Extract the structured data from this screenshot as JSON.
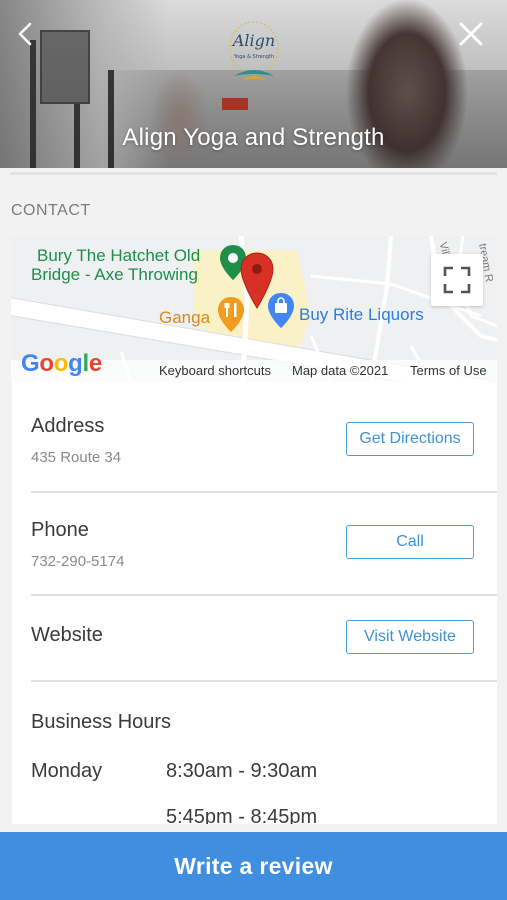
{
  "header": {
    "title": "Align Yoga and Strength",
    "logo_text": "Align",
    "logo_subtext": "Yoga & Strength"
  },
  "icons": {
    "back": "chevron-left-icon",
    "close": "close-icon",
    "fullscreen": "fullscreen-icon",
    "map_pin": "map-pin-icon"
  },
  "contact": {
    "section_label": "CONTACT"
  },
  "map": {
    "poi_hatchet_line1": "Bury The Hatchet Old",
    "poi_hatchet_line2": "Bridge - Axe Throwing",
    "poi_ganga": "Ganga",
    "poi_buyrite": "Buy Rite Liquors",
    "street_villa": "Vill",
    "street_stream": "tream R",
    "google_logo": "Google",
    "keyboard_shortcuts": "Keyboard shortcuts",
    "map_data": "Map data ©2021",
    "terms": "Terms of Use"
  },
  "address": {
    "title": "Address",
    "value": "435 Route 34",
    "button": "Get Directions"
  },
  "phone": {
    "title": "Phone",
    "value": "732-290-5174",
    "button": "Call"
  },
  "website": {
    "title": "Website",
    "button": "Visit Website"
  },
  "hours": {
    "title": "Business Hours",
    "rows": [
      {
        "day": "Monday",
        "time1": "8:30am - 9:30am",
        "time2": "5:45pm - 8:45pm"
      }
    ]
  },
  "footer": {
    "review_button": "Write a review"
  },
  "colors": {
    "accent": "#3f8ee0",
    "button_border": "#4a9ed8",
    "poi_green": "#1e8f4a",
    "poi_orange": "#d98a1a",
    "poi_blue": "#2b7de0",
    "pin_red": "#d93025"
  }
}
